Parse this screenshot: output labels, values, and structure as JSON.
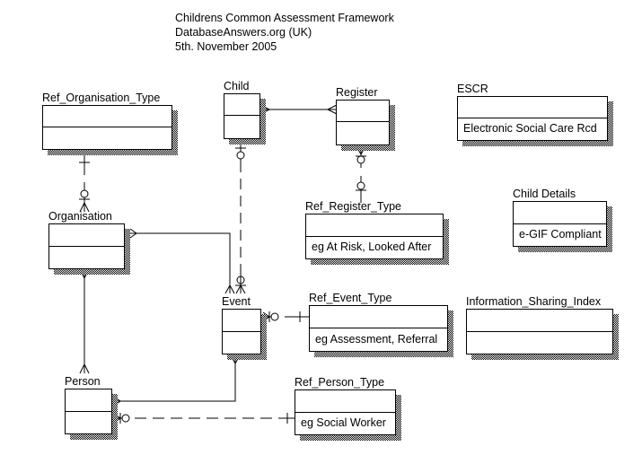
{
  "header": {
    "title": "Childrens Common Assessment Framework",
    "source": "DatabaseAnswers.org (UK)",
    "date": "5th. November 2005"
  },
  "entities": {
    "ref_organisation_type": {
      "name": "Ref_Organisation_Type",
      "note": ""
    },
    "child": {
      "name": "Child",
      "note": ""
    },
    "register": {
      "name": "Register",
      "note": ""
    },
    "escr": {
      "name": "ESCR",
      "note": "Electronic Social Care Rcd"
    },
    "ref_register_type": {
      "name": "Ref_Register_Type",
      "note": "eg At Risk, Looked After"
    },
    "child_details": {
      "name": "Child Details",
      "note": "e-GIF Compliant"
    },
    "organisation": {
      "name": "Organisation",
      "note": ""
    },
    "event": {
      "name": "Event",
      "note": ""
    },
    "ref_event_type": {
      "name": "Ref_Event_Type",
      "note": "eg Assessment, Referral"
    },
    "information_sharing_index": {
      "name": "Information_Sharing_Index",
      "note": ""
    },
    "person": {
      "name": "Person",
      "note": ""
    },
    "ref_person_type": {
      "name": "Ref_Person_Type",
      "note": "eg Social Worker"
    }
  },
  "relationships": [
    {
      "from": "Ref_Organisation_Type",
      "to": "Organisation",
      "style": "solid",
      "from_end": "one",
      "to_end": "zero-or-many"
    },
    {
      "from": "Child",
      "to": "Register",
      "style": "solid",
      "from_end": "many",
      "to_end": "many"
    },
    {
      "from": "Child",
      "to": "Event",
      "style": "dashed",
      "from_end": "zero-or-one",
      "to_end": "zero-or-many"
    },
    {
      "from": "Register",
      "to": "Ref_Register_Type",
      "style": "solid",
      "from_end": "zero-or-many",
      "to_end": "zero-or-one"
    },
    {
      "from": "Organisation",
      "to": "Event",
      "style": "solid",
      "from_end": "many",
      "to_end": "many"
    },
    {
      "from": "Organisation",
      "to": "Person",
      "style": "solid",
      "from_end": "many",
      "to_end": "many"
    },
    {
      "from": "Event",
      "to": "Ref_Event_Type",
      "style": "solid",
      "from_end": "zero-or-many",
      "to_end": "one"
    },
    {
      "from": "Event",
      "to": "Person",
      "style": "solid",
      "from_end": "many",
      "to_end": "many"
    },
    {
      "from": "Person",
      "to": "Ref_Person_Type",
      "style": "dashed",
      "from_end": "zero-or-many",
      "to_end": "one"
    }
  ]
}
